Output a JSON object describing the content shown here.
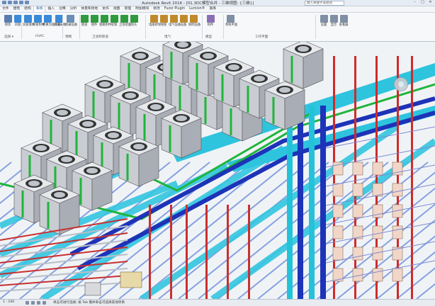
{
  "window": {
    "title": "Autodesk Revit 2016 - [01.3DC模型合并 - 三维视图: {三维}]",
    "search_placeholder": "键入关键字或短语"
  },
  "menu": {
    "tabs": [
      {
        "label": "文件"
      },
      {
        "label": "建筑"
      },
      {
        "label": "结构"
      },
      {
        "label": "系统"
      },
      {
        "label": "插入"
      },
      {
        "label": "注释"
      },
      {
        "label": "分析"
      },
      {
        "label": "体量和场地"
      },
      {
        "label": "协作"
      },
      {
        "label": "视图"
      },
      {
        "label": "管理"
      },
      {
        "label": "附加模块"
      },
      {
        "label": "修改"
      },
      {
        "label": "Fuzor Plugin"
      },
      {
        "label": "Lumion®"
      },
      {
        "label": "族库"
      }
    ]
  },
  "ribbon": {
    "buttons": [
      {
        "label": "修改",
        "color": "#5a7db0"
      },
      {
        "label": "风管",
        "color": "#3b8ad9"
      },
      {
        "label": "风管管件",
        "color": "#3b8ad9"
      },
      {
        "label": "风管附件",
        "color": "#3b8ad9"
      },
      {
        "label": "转换为软风管",
        "color": "#3b8ad9"
      },
      {
        "label": "风道末端",
        "color": "#3b8ad9"
      },
      {
        "label": "机械设备",
        "color": "#6a8fb5"
      },
      {
        "label": "管道",
        "color": "#2f9a3e"
      },
      {
        "label": "管件",
        "color": "#2f9a3e"
      },
      {
        "label": "管路附件",
        "color": "#2f9a3e"
      },
      {
        "label": "软管",
        "color": "#2f9a3e"
      },
      {
        "label": "卫浴装置",
        "color": "#2f9a3e"
      },
      {
        "label": "喷头",
        "color": "#2f9a3e"
      },
      {
        "label": "电缆桥架",
        "color": "#c08a2b"
      },
      {
        "label": "线管",
        "color": "#c08a2b"
      },
      {
        "label": "电气设备",
        "color": "#c08a2b"
      },
      {
        "label": "设备",
        "color": "#c08a2b"
      },
      {
        "label": "照明设备",
        "color": "#c08a2b"
      },
      {
        "label": "构件",
        "color": "#8a6fb5"
      },
      {
        "label": "参照平面",
        "color": "#7f8fa5"
      },
      {
        "label": "设置",
        "color": "#7f8fa5"
      },
      {
        "label": "显示",
        "color": "#7f8fa5"
      },
      {
        "label": "查看器",
        "color": "#7f8fa5"
      }
    ],
    "groups": [
      {
        "label": "选择 ▾"
      },
      {
        "label": "HVAC"
      },
      {
        "label": "预制"
      },
      {
        "label": "卫浴和管道"
      },
      {
        "label": "电气"
      },
      {
        "label": "模型"
      },
      {
        "label": "工作平面"
      }
    ]
  },
  "statusbar": {
    "scale": "1 : 100",
    "hint": "单击可进行选择; 按 Tab 键并单击可选择其他项目"
  }
}
